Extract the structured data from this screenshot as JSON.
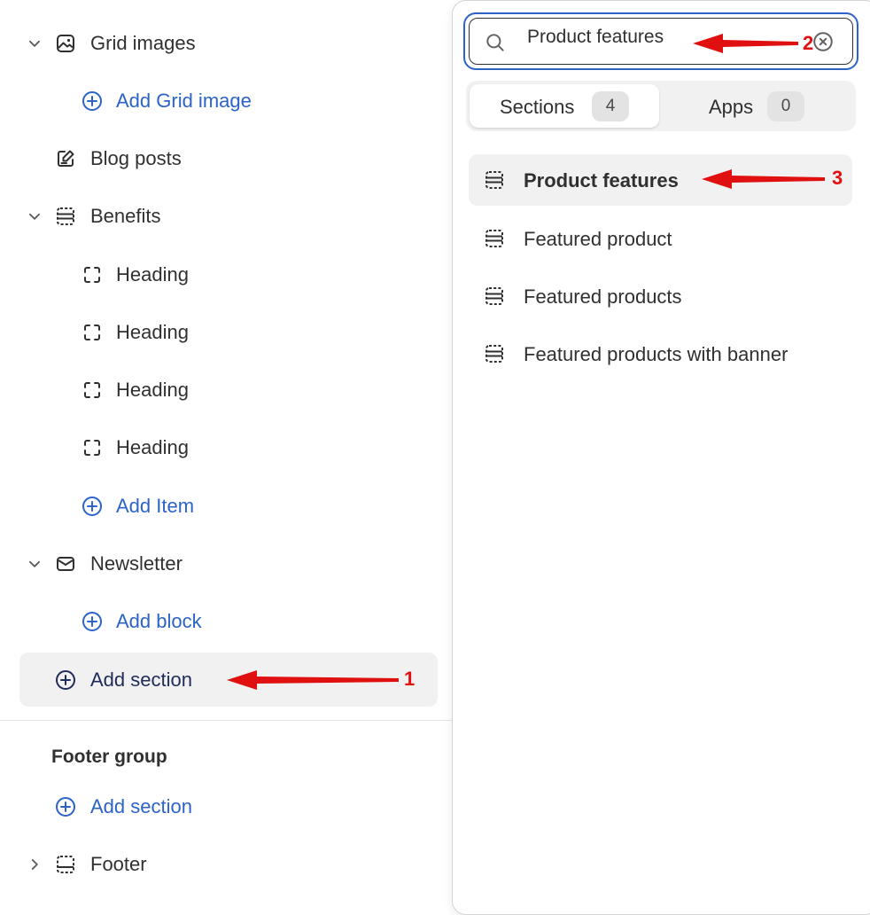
{
  "left_panel": {
    "grid_images": "Grid images",
    "add_grid_image": "Add Grid image",
    "blog_posts": "Blog posts",
    "benefits": "Benefits",
    "headings": [
      "Heading",
      "Heading",
      "Heading",
      "Heading"
    ],
    "add_item": "Add Item",
    "newsletter": "Newsletter",
    "add_block": "Add block",
    "add_section": "Add section",
    "footer_group_title": "Footer group",
    "footer_add_section": "Add section",
    "footer": "Footer"
  },
  "popover": {
    "search_value": "Product features",
    "tabs": [
      {
        "label": "Sections",
        "count": "4"
      },
      {
        "label": "Apps",
        "count": "0"
      }
    ],
    "results": [
      "Product features",
      "Featured product",
      "Featured products",
      "Featured products with banner"
    ]
  },
  "annotations": [
    "1",
    "2",
    "3"
  ],
  "colors": {
    "accent_blue": "#2c63c9",
    "arrow_red": "#e01010",
    "highlight_gray": "#f1f1f1",
    "text_dark": "#303030"
  },
  "icons": {
    "chevron_down": "chevron-down-icon",
    "chevron_right": "chevron-right-icon",
    "image": "image-icon",
    "edit_page": "edit-page-icon",
    "section": "section-icon",
    "block": "block-icon",
    "add_circle": "add-circle-icon",
    "mail": "mail-icon",
    "search": "search-icon",
    "clear": "clear-search-icon",
    "footer": "footer-icon"
  }
}
